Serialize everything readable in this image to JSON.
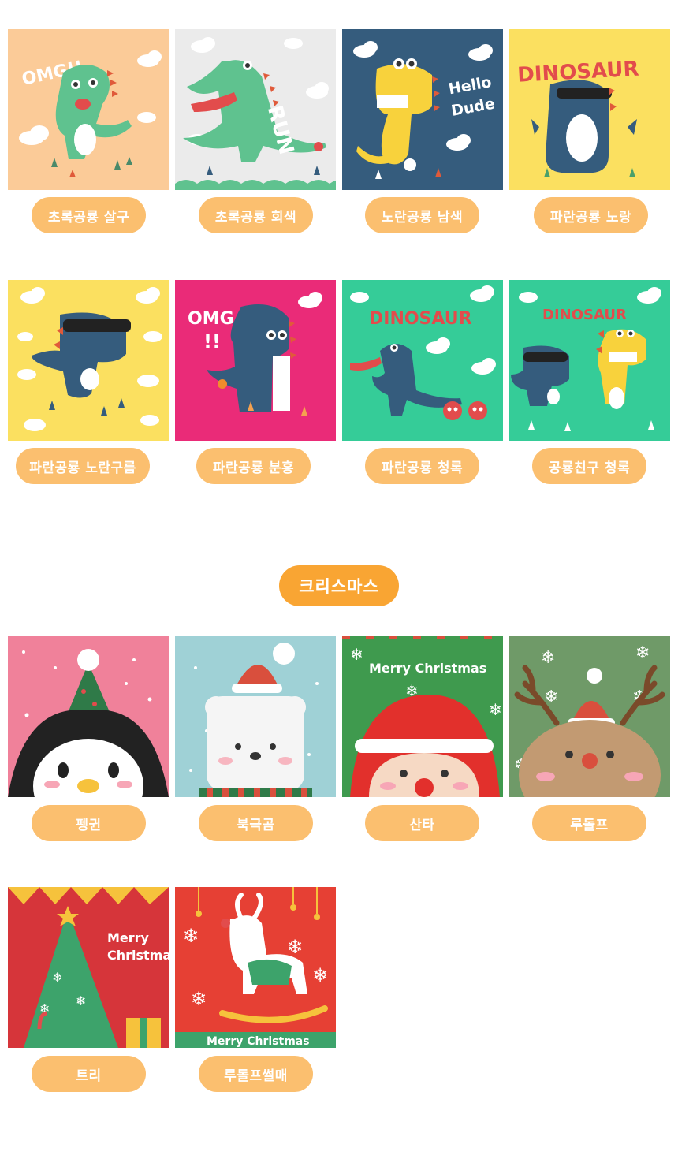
{
  "dinosaur_products": [
    {
      "label": "초록공룡 살구",
      "bg": "#fbcb98",
      "art": "green-dino-omg"
    },
    {
      "label": "초록공룡 회색",
      "bg": "#ebebeb",
      "art": "green-dino-run"
    },
    {
      "label": "노란공룡 남색",
      "bg": "#355c7d",
      "art": "yellow-dino-hello-dude"
    },
    {
      "label": "파란공룡 노랑",
      "bg": "#fbe060",
      "art": "blue-dino-dinosaur"
    },
    {
      "label": "파란공룡 노란구름",
      "bg": "#fbe060",
      "art": "blue-dino-sunglasses"
    },
    {
      "label": "파란공룡 분홍",
      "bg": "#ea2b78",
      "art": "blue-dino-omg"
    },
    {
      "label": "파란공룡 청록",
      "bg": "#35cc98",
      "art": "blue-dino-dinosaur-teal"
    },
    {
      "label": "공룡친구 청록",
      "bg": "#35cc98",
      "art": "dino-friends"
    }
  ],
  "art_text": {
    "omg": "OMG!!",
    "run": "RUN",
    "hello": "Hello",
    "dude": "Dude",
    "dinosaur": "DINOSAUR",
    "omg_short": "OMG",
    "bangs": "!!",
    "merry": "Merry",
    "christmas": "Christmas",
    "merry_christmas": "Merry Christmas"
  },
  "christmas_section": {
    "title": "크리스마스",
    "products": [
      {
        "label": "펭귄",
        "bg": "#f0819a",
        "art": "penguin"
      },
      {
        "label": "북극곰",
        "bg": "#9fd1d6",
        "art": "polar-bear"
      },
      {
        "label": "산타",
        "bg": "#3f9a4e",
        "art": "santa"
      },
      {
        "label": "루돌프",
        "bg": "#6f9a68",
        "art": "rudolph"
      },
      {
        "label": "트리",
        "bg": "#d6353a",
        "art": "tree"
      },
      {
        "label": "루돌프썰매",
        "bg": "#e64034",
        "art": "rudolph-sled"
      }
    ]
  },
  "colors": {
    "pill": "#fbbf6f",
    "section_pill": "#f9a533"
  }
}
